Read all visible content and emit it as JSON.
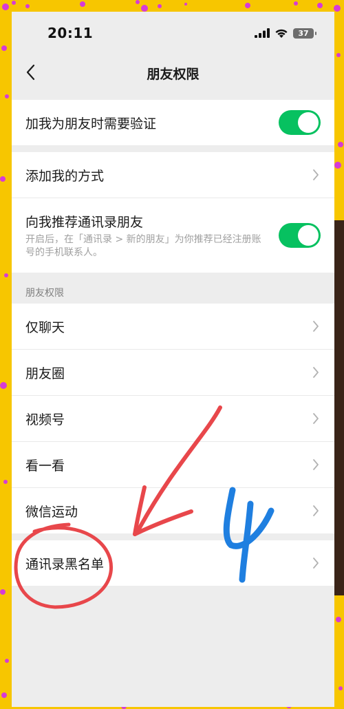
{
  "status_bar": {
    "time": "20:11",
    "battery": "37"
  },
  "nav": {
    "title": "朋友权限",
    "back_icon": "chevron-left-icon"
  },
  "groups": {
    "verify": {
      "label": "加我为朋友时需要验证",
      "toggle_on": true
    },
    "add_method": {
      "label": "添加我的方式"
    },
    "recommend": {
      "label": "向我推荐通讯录朋友",
      "description": "开启后，在「通讯录 > 新的朋友」为你推荐已经注册账号的手机联系人。",
      "toggle_on": true
    }
  },
  "permissions_section": {
    "header": "朋友权限",
    "items": [
      {
        "label": "仅聊天"
      },
      {
        "label": "朋友圈"
      },
      {
        "label": "视频号"
      },
      {
        "label": "看一看"
      },
      {
        "label": "微信运动"
      }
    ]
  },
  "blacklist": {
    "label": "通讯录黑名单"
  },
  "annotation": {
    "step_number": "4",
    "arrow_color": "#e8474b",
    "number_color": "#1f7fe0"
  },
  "colors": {
    "toggle_on": "#07c160",
    "frame": "#f7c600",
    "frame_dots": "#d63bd6"
  }
}
